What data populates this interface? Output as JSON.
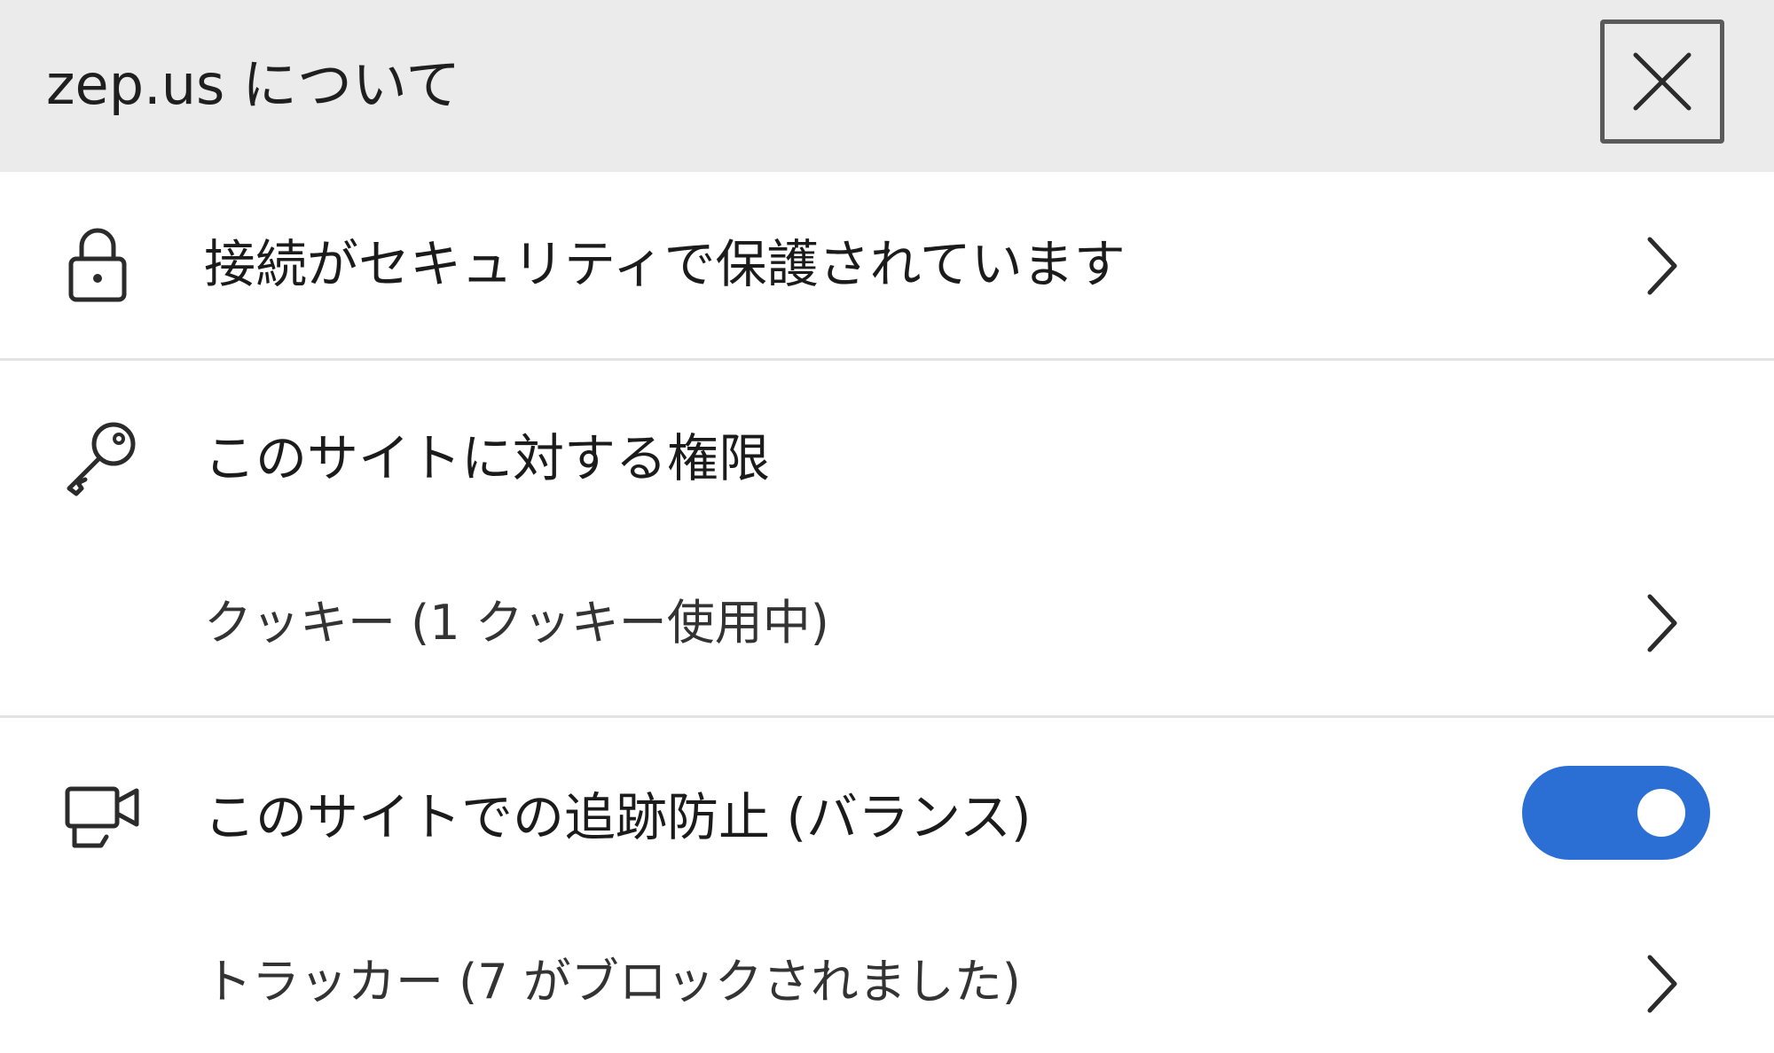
{
  "header": {
    "title": "zep.us について"
  },
  "rows": {
    "connection": {
      "label": "接続がセキュリティで保護されています",
      "icon": "lock-icon"
    },
    "permissions": {
      "label": "このサイトに対する権限",
      "icon": "key-icon"
    },
    "cookies": {
      "label": "クッキー (1 クッキー使用中)"
    },
    "tracking": {
      "label": "このサイトでの追跡防止 (バランス)",
      "icon": "tracking-camera-icon",
      "toggle_on": true
    },
    "trackers": {
      "label": "トラッカー (7 がブロックされました)"
    }
  },
  "colors": {
    "header_bg": "#ebebeb",
    "toggle_on": "#2c6fd4",
    "divider": "#e3e3e3"
  }
}
